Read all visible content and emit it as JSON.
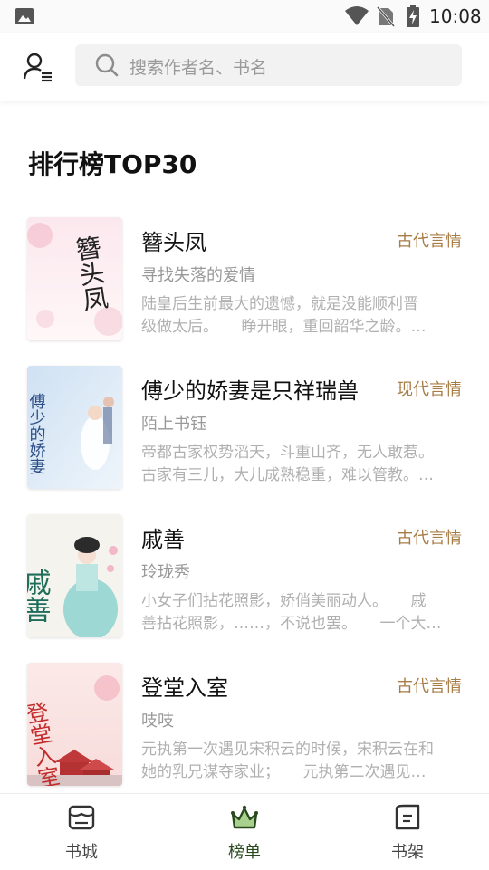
{
  "status_bar": {
    "time": "10:08"
  },
  "search": {
    "placeholder": "搜索作者名、书名"
  },
  "section": {
    "title": "排行榜TOP30"
  },
  "books": [
    {
      "title": "簪头凤",
      "genre": "古代言情",
      "author": "寻找失落的爱情",
      "desc_line1": "陆皇后生前最大的遗憾，就是没能顺利晋",
      "desc_line2": "级做太后。　　睁开眼，重回韶华之龄。…",
      "cover_title": "簪头凤"
    },
    {
      "title": "傅少的娇妻是只祥瑞兽",
      "genre": "现代言情",
      "author": "陌上书钰",
      "desc_line1": "帝都古家权势滔天，斗重山齐，无人敢惹。",
      "desc_line2": "古家有三儿，大儿成熟稳重，难以管教。…",
      "cover_title": "傅少的娇妻"
    },
    {
      "title": "戚善",
      "genre": "古代言情",
      "author": "玲珑秀",
      "desc_line1": "小女子们拈花照影，娇俏美丽动人。　　戚",
      "desc_line2": "善拈花照影，……，不说也罢。　　一个大…",
      "cover_title": "戚善"
    },
    {
      "title": "登堂入室",
      "genre": "古代言情",
      "author": "吱吱",
      "desc_line1": "元执第一次遇见宋积云的时候，宋积云在和",
      "desc_line2": "她的乳兄谋夺家业；　　元执第二次遇见…",
      "cover_title": "登堂入室"
    }
  ],
  "tabs": [
    {
      "label": "书城",
      "icon": "store-icon",
      "active": false
    },
    {
      "label": "榜单",
      "icon": "crown-icon",
      "active": true
    },
    {
      "label": "书架",
      "icon": "bookshelf-icon",
      "active": false
    }
  ],
  "colors": {
    "accent_dark_green": "#2a4a1e",
    "active_tab_fill": "#a9d18e",
    "genre_gold": "#a87c45",
    "muted_text": "#b0b0b0"
  }
}
